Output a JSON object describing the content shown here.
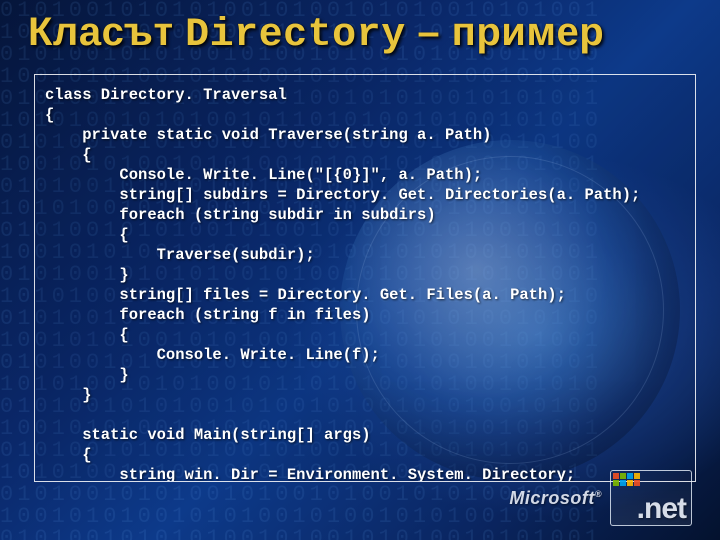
{
  "title": {
    "text_prefix": "Класът ",
    "code_word": "Directory",
    "text_suffix": " – пример"
  },
  "code": "class Directory. Traversal\n{\n    private static void Traverse(string a. Path)\n    {\n        Console. Write. Line(\"[{0}]\", a. Path);\n        string[] subdirs = Directory. Get. Directories(a. Path);\n        foreach (string subdir in subdirs)\n        {\n            Traverse(subdir);\n        }\n        string[] files = Directory. Get. Files(a. Path);\n        foreach (string f in files)\n        {\n            Console. Write. Line(f);\n        }\n    }\n\n    static void Main(string[] args)\n    {\n        string win. Dir = Environment. System. Directory;\n        Traverse(win. Dir);\n    }\n}",
  "logo": {
    "company": "Microsoft",
    "reg": "®",
    "product": ".net"
  },
  "bg_binary": "01010010101010010100101010010101001\n10101001010100101101010010100101010\n01010010101001010010100101010010100\n10010101001010100101001010100101001\n01010010101010010100101010010101001\n10101001010100101101010010100101010\n01010010101001010010100101010010100\n10010101001010100101001010100101001\n01010010101010010100101010010101001\n10101001010100101101010010100101010\n01010010101001010010100101010010100\n10010101001010100101001010100101001\n01010010101010010100101010010101001\n10101001010100101101010010100101010\n01010010101001010010100101010010100\n10010101001010100101001010100101001\n01010010101010010100101010010101001\n10101001010100101101010010100101010\n01010010101001010010100101010010100\n10010101001010100101001010100101001\n01010010101010010100101010010101001\n10101001010100101101010010100101010\n01010010101001010010100101010010100\n10010101001010100101001010100101001\n01010010101010010100101010010101001"
}
